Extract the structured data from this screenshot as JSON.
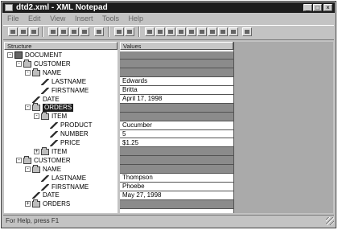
{
  "window": {
    "title": "dtd2.xml - XML Notepad"
  },
  "menu": [
    "File",
    "Edit",
    "View",
    "Insert",
    "Tools",
    "Help"
  ],
  "columns": {
    "structure": "Structure",
    "values": "Values"
  },
  "tree": [
    {
      "label": "DOCUMENT",
      "type": "doc",
      "depth": 0,
      "expander": "-"
    },
    {
      "label": "CUSTOMER",
      "type": "folder",
      "depth": 1,
      "expander": "-"
    },
    {
      "label": "NAME",
      "type": "folder",
      "depth": 2,
      "expander": "-"
    },
    {
      "label": "LASTNAME",
      "type": "leaf",
      "depth": 3,
      "expander": ""
    },
    {
      "label": "FIRSTNAME",
      "type": "leaf",
      "depth": 3,
      "expander": ""
    },
    {
      "label": "DATE",
      "type": "leaf",
      "depth": 2,
      "expander": ""
    },
    {
      "label": "ORDERS",
      "type": "folder",
      "depth": 2,
      "expander": "-",
      "selected": true
    },
    {
      "label": "ITEM",
      "type": "folder",
      "depth": 3,
      "expander": "-"
    },
    {
      "label": "PRODUCT",
      "type": "leaf",
      "depth": 4,
      "expander": ""
    },
    {
      "label": "NUMBER",
      "type": "leaf",
      "depth": 4,
      "expander": ""
    },
    {
      "label": "PRICE",
      "type": "leaf",
      "depth": 4,
      "expander": ""
    },
    {
      "label": "ITEM",
      "type": "folder",
      "depth": 3,
      "expander": "+"
    },
    {
      "label": "CUSTOMER",
      "type": "folder",
      "depth": 1,
      "expander": "-"
    },
    {
      "label": "NAME",
      "type": "folder",
      "depth": 2,
      "expander": "-"
    },
    {
      "label": "LASTNAME",
      "type": "leaf",
      "depth": 3,
      "expander": ""
    },
    {
      "label": "FIRSTNAME",
      "type": "leaf",
      "depth": 3,
      "expander": ""
    },
    {
      "label": "DATE",
      "type": "leaf",
      "depth": 2,
      "expander": ""
    },
    {
      "label": "ORDERS",
      "type": "folder",
      "depth": 2,
      "expander": "+"
    }
  ],
  "values": [
    {
      "text": "",
      "kind": "gray"
    },
    {
      "text": "",
      "kind": "gray"
    },
    {
      "text": "",
      "kind": "gray"
    },
    {
      "text": "Edwards",
      "kind": "white"
    },
    {
      "text": "Britta",
      "kind": "white"
    },
    {
      "text": "April 17, 1998",
      "kind": "white"
    },
    {
      "text": "",
      "kind": "gray"
    },
    {
      "text": "",
      "kind": "gray"
    },
    {
      "text": "Cucumber",
      "kind": "white"
    },
    {
      "text": "5",
      "kind": "white"
    },
    {
      "text": "$1.25",
      "kind": "white"
    },
    {
      "text": "",
      "kind": "gray"
    },
    {
      "text": "",
      "kind": "gray"
    },
    {
      "text": "",
      "kind": "gray"
    },
    {
      "text": "Thompson",
      "kind": "white"
    },
    {
      "text": "Phoebe",
      "kind": "white"
    },
    {
      "text": "May 27, 1998",
      "kind": "white"
    },
    {
      "text": "",
      "kind": "gray"
    }
  ],
  "status": {
    "text": "For Help, press F1"
  }
}
